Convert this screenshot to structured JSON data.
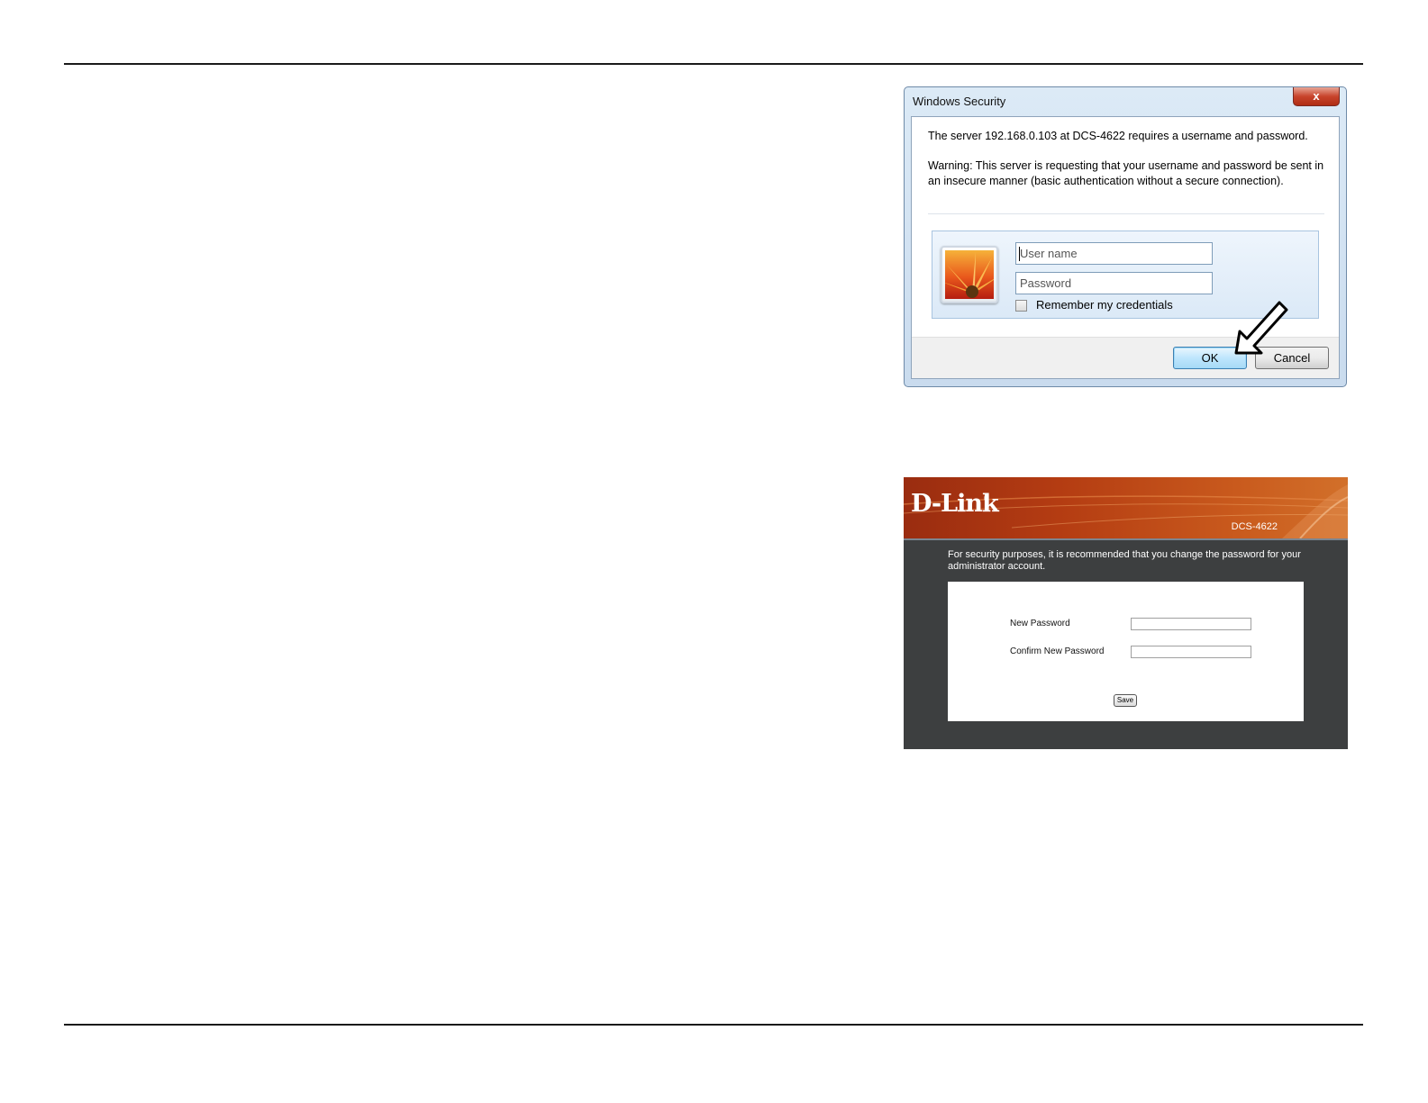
{
  "win_dialog": {
    "title": "Windows Security",
    "close_glyph": "x",
    "server_message": "The server 192.168.0.103 at DCS-4622 requires a username and password.",
    "warning_message": "Warning: This server is requesting that your username and password be sent in an insecure manner (basic authentication without a secure connection).",
    "username_placeholder": "User name",
    "password_placeholder": "Password",
    "remember_label": "Remember my credentials",
    "ok_label": "OK",
    "cancel_label": "Cancel",
    "icons": {
      "user_tile": "user-tile-icon",
      "pointer": "arrow-pointer-icon"
    }
  },
  "dlink_page": {
    "logo_text": "D-Link",
    "logo_registered": "®",
    "model": "DCS-4622",
    "notice": "For security purposes, it is recommended that you change the password for your administrator account.",
    "new_password_label": "New Password",
    "confirm_password_label": "Confirm New Password",
    "save_label": "Save",
    "colors": {
      "header_orange": "#c54f18",
      "body_dark": "#3d3f40"
    }
  }
}
